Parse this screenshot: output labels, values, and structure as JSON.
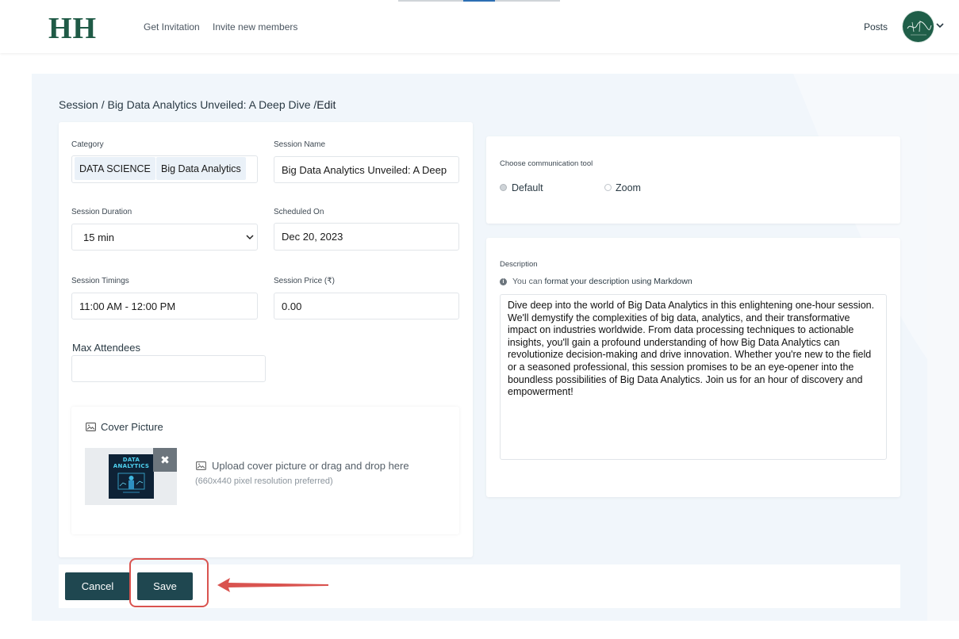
{
  "header": {
    "logo": "HH",
    "nav": [
      "Get Invitation",
      "Invite new members"
    ],
    "posts": "Posts"
  },
  "breadcrumb": {
    "path": "Session / Big Data Analytics Unveiled: A Deep Dive /",
    "current": "Edit"
  },
  "form": {
    "category_label": "Category",
    "category_tags": [
      "DATA SCIENCE",
      "Big Data Analytics"
    ],
    "session_name_label": "Session Name",
    "session_name_value": "Big Data Analytics Unveiled: A Deep",
    "duration_label": "Session Duration",
    "duration_value": "15 min",
    "scheduled_label": "Scheduled On",
    "scheduled_value": "Dec 20, 2023",
    "timings_label": "Session Timings",
    "timings_value": "11:00 AM - 12:00 PM",
    "price_label": "Session Price (₹)",
    "price_value": "0.00",
    "max_attendees_label": "Max Attendees",
    "max_attendees_value": ""
  },
  "cover": {
    "title": "Cover Picture",
    "thumb_line1": "DATA",
    "thumb_line2": "ANALYTICS",
    "remove_glyph": "✖",
    "upload_text": "Upload cover picture or drag and drop here",
    "upload_hint": "(660x440 pixel resolution preferred)"
  },
  "communication": {
    "label": "Choose communication tool",
    "options": [
      "Default",
      "Zoom"
    ],
    "selected": "Default"
  },
  "description": {
    "label": "Description",
    "info_prefix": "You can",
    "info_link": "format your description using Markdown",
    "text": "Dive deep into the world of Big Data Analytics in this enlightening one-hour session. We'll demystify the complexities of big data, analytics, and their transformative impact on industries worldwide. From data processing techniques to actionable insights, you'll gain a profound understanding of how Big Data Analytics can revolutionize decision-making and drive innovation. Whether you're new to the field or a seasoned professional, this session promises to be an eye-opener into the boundless possibilities of Big Data Analytics. Join us for an hour of discovery and empowerment!"
  },
  "actions": {
    "cancel": "Cancel",
    "save": "Save"
  },
  "colors": {
    "brand": "#1f5a46",
    "button": "#1f4750",
    "highlight": "#d9534f"
  }
}
